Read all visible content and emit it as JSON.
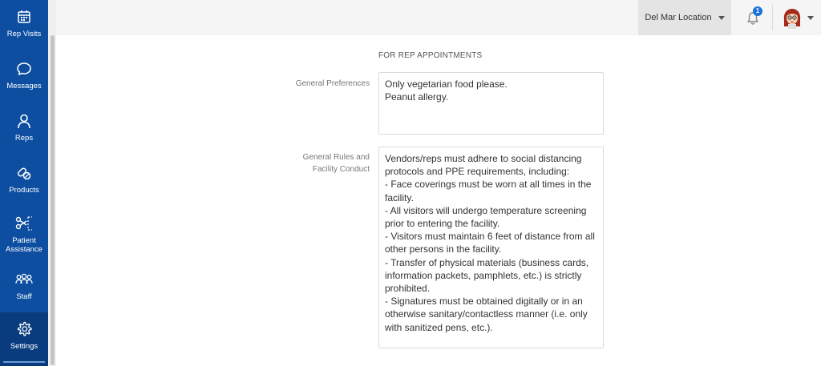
{
  "sidebar": {
    "items": [
      {
        "label": "Rep Visits",
        "icon": "calendar-icon"
      },
      {
        "label": "Messages",
        "icon": "chat-bubble-icon"
      },
      {
        "label": "Reps",
        "icon": "person-icon"
      },
      {
        "label": "Products",
        "icon": "pills-icon"
      },
      {
        "label": "Patient Assistance",
        "icon": "scissors-coupon-icon"
      },
      {
        "label": "Staff",
        "icon": "group-icon"
      },
      {
        "label": "Settings",
        "icon": "gear-icon"
      }
    ],
    "active": "Settings"
  },
  "header": {
    "location": "Del Mar Location",
    "notifications_count": "1"
  },
  "main": {
    "section_title": "FOR REP APPOINTMENTS",
    "fields": [
      {
        "label": "General Preferences",
        "value": "Only vegetarian food please.\nPeanut allergy."
      },
      {
        "label": "General Rules and Facility Conduct",
        "value": "Vendors/reps must adhere to social distancing protocols and PPE requirements, including:\n- Face coverings must be worn at all times in the facility.\n- All visitors will undergo temperature screening prior to entering the facility.\n- Visitors must maintain 6 feet of distance from all other persons in the facility.\n- Transfer of physical materials (business cards, information packets, pamphlets, etc.) is strictly prohibited.\n- Signatures must be obtained digitally or in an otherwise sanitary/contactless manner (i.e. only with sanitized pens, etc.)."
      }
    ]
  },
  "colors": {
    "sidebar": "#0d4ea0",
    "sidebar_active": "#093c7e",
    "badge": "#1b72d8"
  }
}
